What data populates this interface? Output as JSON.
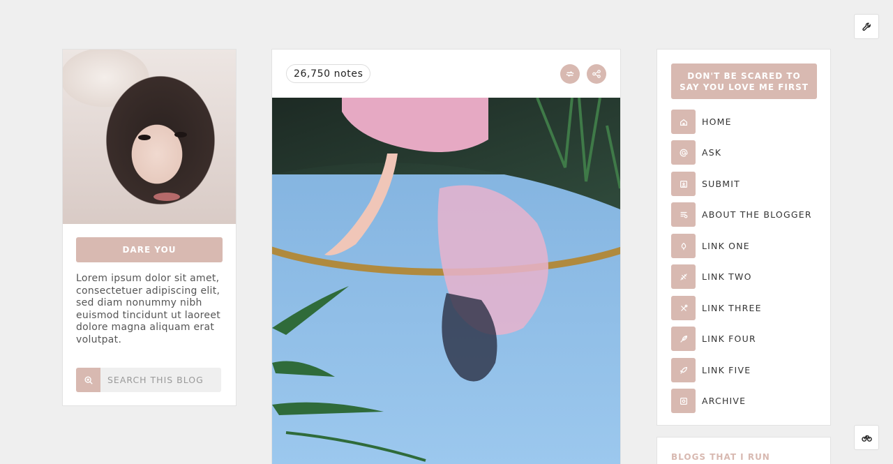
{
  "colors": {
    "accent": "#d8b9b1",
    "background": "#efefef",
    "card": "#ffffff"
  },
  "corner": {
    "top_icon": "wrench-icon",
    "bottom_icon": "bicycle-icon"
  },
  "sidebar_left": {
    "portrait_alt": "portrait",
    "button_label": "DARE YOU",
    "description": "Lorem ipsum dolor sit amet, consectetuer adipiscing elit, sed diam nonummy nibh euismod tincidunt ut laoreet dolore magna aliquam erat volutpat.",
    "search": {
      "icon": "zoom-icon",
      "placeholder": "SEARCH THIS BLOG"
    }
  },
  "post": {
    "notes": "26,750 notes",
    "reblog_icon": "reblog-icon",
    "share_icon": "share-icon"
  },
  "sidebar_right": {
    "title": "DON'T BE SCARED TO SAY YOU LOVE ME FIRST",
    "nav": [
      {
        "label": "HOME",
        "icon": "home-icon"
      },
      {
        "label": "ASK",
        "icon": "at-icon"
      },
      {
        "label": "SUBMIT",
        "icon": "submit-icon"
      },
      {
        "label": "ABOUT THE BLOGGER",
        "icon": "about-icon"
      },
      {
        "label": "LINK ONE",
        "icon": "flower-icon"
      },
      {
        "label": "LINK TWO",
        "icon": "plane-icon"
      },
      {
        "label": "LINK THREE",
        "icon": "tools-icon"
      },
      {
        "label": "LINK FOUR",
        "icon": "feather-icon"
      },
      {
        "label": "LINK FIVE",
        "icon": "rocket-icon"
      },
      {
        "label": "ARCHIVE",
        "icon": "archive-icon"
      }
    ],
    "blogs_title": "BLOGS THAT I RUN"
  }
}
